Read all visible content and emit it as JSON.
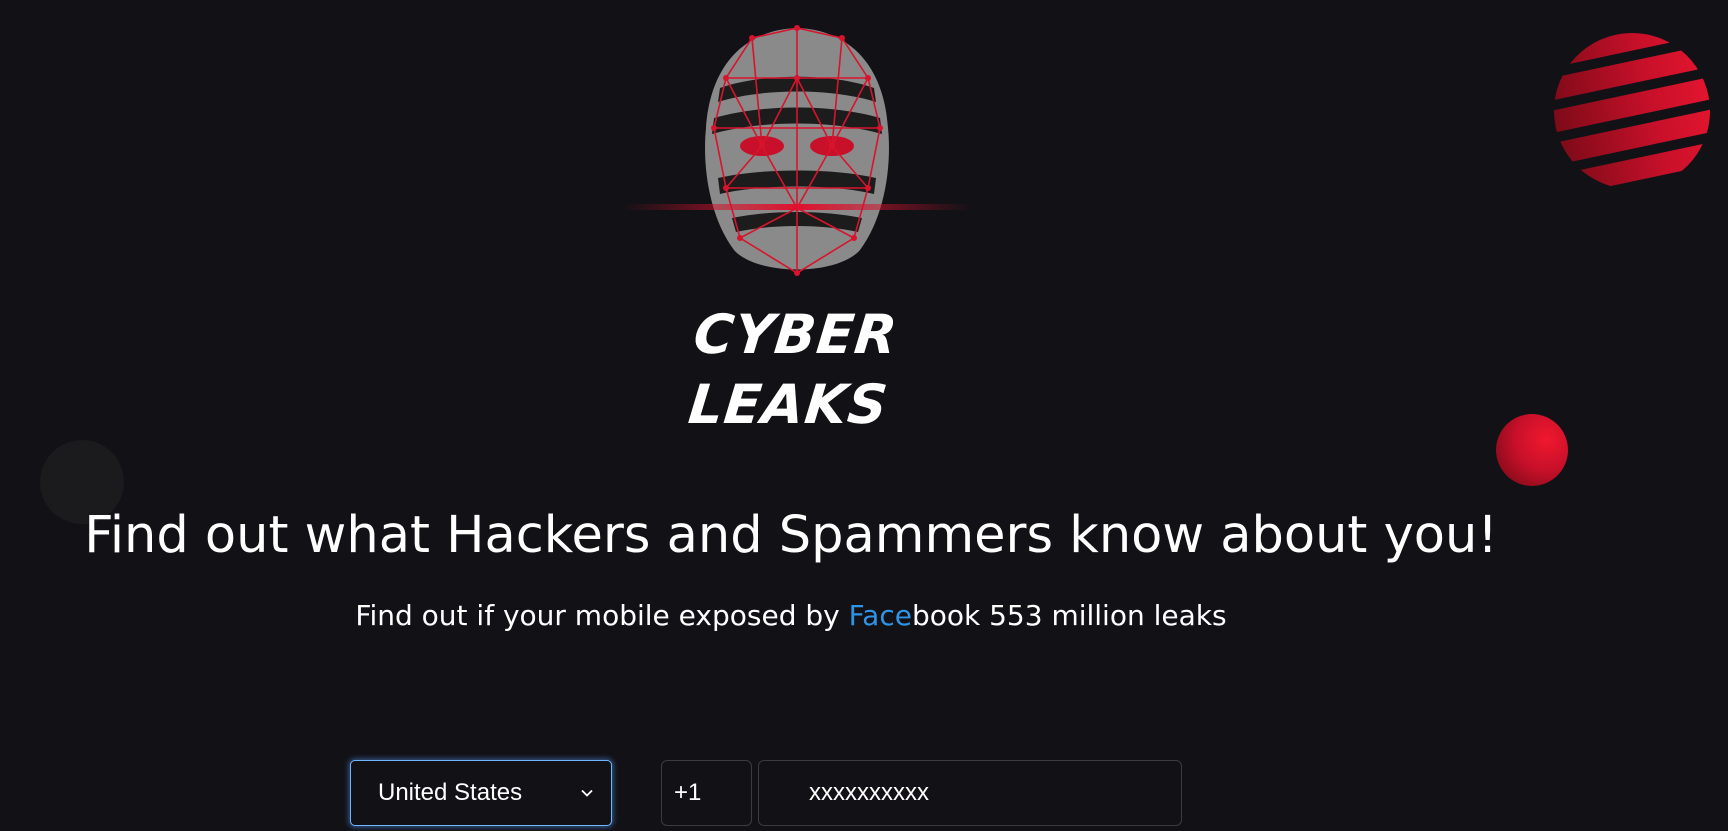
{
  "brand": {
    "name": "CYBER LEAKS",
    "accent_color": "#c8102a",
    "link_color": "#2f93e6"
  },
  "hero": {
    "headline": "Find out what Hackers and Spammers know about you!",
    "subline_prefix": "Find out if your mobile exposed by ",
    "subline_brand_highlight": "Face",
    "subline_brand_rest": "book",
    "subline_suffix": " 553 million leaks"
  },
  "form": {
    "country_selected": "United States",
    "dial_code": "+1",
    "phone_placeholder": "xxxxxxxxxx"
  },
  "icons": {
    "logo": "hacker-mask-face-mesh-icon",
    "select_arrow": "chevron-down-icon"
  }
}
